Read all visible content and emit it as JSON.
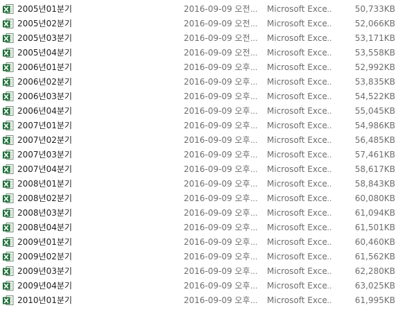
{
  "colors": {
    "name_text": "#1e1e1e",
    "detail_text": "#6d6d6d",
    "excel_green": "#1d7a3a"
  },
  "icon": "excel-file-icon",
  "ellipsis": "...",
  "files": [
    {
      "name": "2005년01분기",
      "date": "2016-09-09 오전",
      "type": "Microsoft Excel",
      "size": "50,733KB"
    },
    {
      "name": "2005년02분기",
      "date": "2016-09-09 오전",
      "type": "Microsoft Excel",
      "size": "52,066KB"
    },
    {
      "name": "2005년03분기",
      "date": "2016-09-09 오전",
      "type": "Microsoft Excel",
      "size": "53,171KB"
    },
    {
      "name": "2005년04분기",
      "date": "2016-09-09 오전",
      "type": "Microsoft Excel",
      "size": "53,558KB"
    },
    {
      "name": "2006년01분기",
      "date": "2016-09-09 오후",
      "type": "Microsoft Excel",
      "size": "52,992KB"
    },
    {
      "name": "2006년02분기",
      "date": "2016-09-09 오후",
      "type": "Microsoft Excel",
      "size": "53,835KB"
    },
    {
      "name": "2006년03분기",
      "date": "2016-09-09 오후",
      "type": "Microsoft Excel",
      "size": "54,522KB"
    },
    {
      "name": "2006년04분기",
      "date": "2016-09-09 오후",
      "type": "Microsoft Excel",
      "size": "55,045KB"
    },
    {
      "name": "2007년01분기",
      "date": "2016-09-09 오후",
      "type": "Microsoft Excel",
      "size": "54,986KB"
    },
    {
      "name": "2007년02분기",
      "date": "2016-09-09 오후",
      "type": "Microsoft Excel",
      "size": "56,485KB"
    },
    {
      "name": "2007년03분기",
      "date": "2016-09-09 오후",
      "type": "Microsoft Excel",
      "size": "57,461KB"
    },
    {
      "name": "2007년04분기",
      "date": "2016-09-09 오후",
      "type": "Microsoft Excel",
      "size": "58,617KB"
    },
    {
      "name": "2008년01분기",
      "date": "2016-09-09 오후",
      "type": "Microsoft Excel",
      "size": "58,843KB"
    },
    {
      "name": "2008년02분기",
      "date": "2016-09-09 오후",
      "type": "Microsoft Excel",
      "size": "60,080KB"
    },
    {
      "name": "2008년03분기",
      "date": "2016-09-09 오후",
      "type": "Microsoft Excel",
      "size": "61,094KB"
    },
    {
      "name": "2008년04분기",
      "date": "2016-09-09 오후",
      "type": "Microsoft Excel",
      "size": "61,501KB"
    },
    {
      "name": "2009년01분기",
      "date": "2016-09-09 오후",
      "type": "Microsoft Excel",
      "size": "60,460KB"
    },
    {
      "name": "2009년02분기",
      "date": "2016-09-09 오후",
      "type": "Microsoft Excel",
      "size": "61,562KB"
    },
    {
      "name": "2009년03분기",
      "date": "2016-09-09 오후",
      "type": "Microsoft Excel",
      "size": "62,280KB"
    },
    {
      "name": "2009년04분기",
      "date": "2016-09-09 오후",
      "type": "Microsoft Excel",
      "size": "63,025KB"
    },
    {
      "name": "2010년01분기",
      "date": "2016-09-09 오후",
      "type": "Microsoft Excel",
      "size": "61,995KB"
    }
  ]
}
